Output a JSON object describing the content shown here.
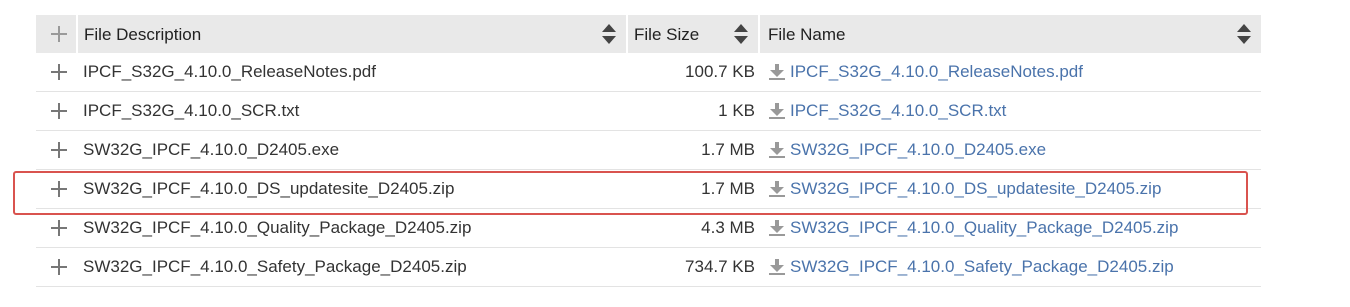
{
  "table": {
    "headers": {
      "description": "File Description",
      "size": "File Size",
      "name": "File Name"
    },
    "rows": [
      {
        "description": "IPCF_S32G_4.10.0_ReleaseNotes.pdf",
        "size": "100.7 KB",
        "name": "IPCF_S32G_4.10.0_ReleaseNotes.pdf"
      },
      {
        "description": "IPCF_S32G_4.10.0_SCR.txt",
        "size": "1 KB",
        "name": "IPCF_S32G_4.10.0_SCR.txt"
      },
      {
        "description": "SW32G_IPCF_4.10.0_D2405.exe",
        "size": "1.7 MB",
        "name": "SW32G_IPCF_4.10.0_D2405.exe"
      },
      {
        "description": "SW32G_IPCF_4.10.0_DS_updatesite_D2405.zip",
        "size": "1.7 MB",
        "name": "SW32G_IPCF_4.10.0_DS_updatesite_D2405.zip"
      },
      {
        "description": "SW32G_IPCF_4.10.0_Quality_Package_D2405.zip",
        "size": "4.3 MB",
        "name": "SW32G_IPCF_4.10.0_Quality_Package_D2405.zip"
      },
      {
        "description": "SW32G_IPCF_4.10.0_Safety_Package_D2405.zip",
        "size": "734.7 KB",
        "name": "SW32G_IPCF_4.10.0_Safety_Package_D2405.zip"
      }
    ],
    "highlighted_row": 3
  },
  "icons": {
    "expand": "plus-icon",
    "sort": "sort-icon",
    "download": "download-icon"
  },
  "colors": {
    "header_bg": "#e9e9e9",
    "link": "#4a73ab",
    "highlight_border": "#d9534f"
  }
}
